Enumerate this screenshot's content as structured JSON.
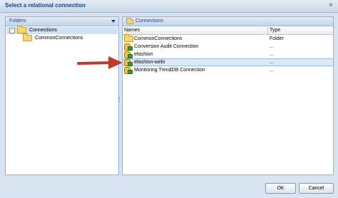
{
  "dialog": {
    "title": "Select a relational connection",
    "close_glyph": "×"
  },
  "folders_panel": {
    "header": "Folders",
    "tree": [
      {
        "label": "Connections",
        "expander": "−",
        "level": 0,
        "selected": true
      },
      {
        "label": "CommonConnections",
        "level": 1,
        "selected": false
      }
    ]
  },
  "connections_panel": {
    "header": "Connections",
    "columns": {
      "name": "Names",
      "type": "Type"
    },
    "rows": [
      {
        "name": "CommonConnections",
        "type": "Folder",
        "icon": "folder-icon"
      },
      {
        "name": "Conversion Audit Connection",
        "type": "...",
        "icon": "connection-icon"
      },
      {
        "name": "efashion",
        "type": "...",
        "icon": "connection-icon"
      },
      {
        "name": "efashion-webi",
        "type": "...",
        "icon": "connection-icon",
        "selected": true
      },
      {
        "name": "Monitoring TrendDB Connection",
        "type": "...",
        "icon": "connection-icon"
      }
    ]
  },
  "buttons": {
    "ok": "OK",
    "cancel": "Cancel"
  },
  "colors": {
    "annotation_arrow": "#c0392b",
    "selection": "#dfe8f6",
    "header_text": "#15428b"
  }
}
